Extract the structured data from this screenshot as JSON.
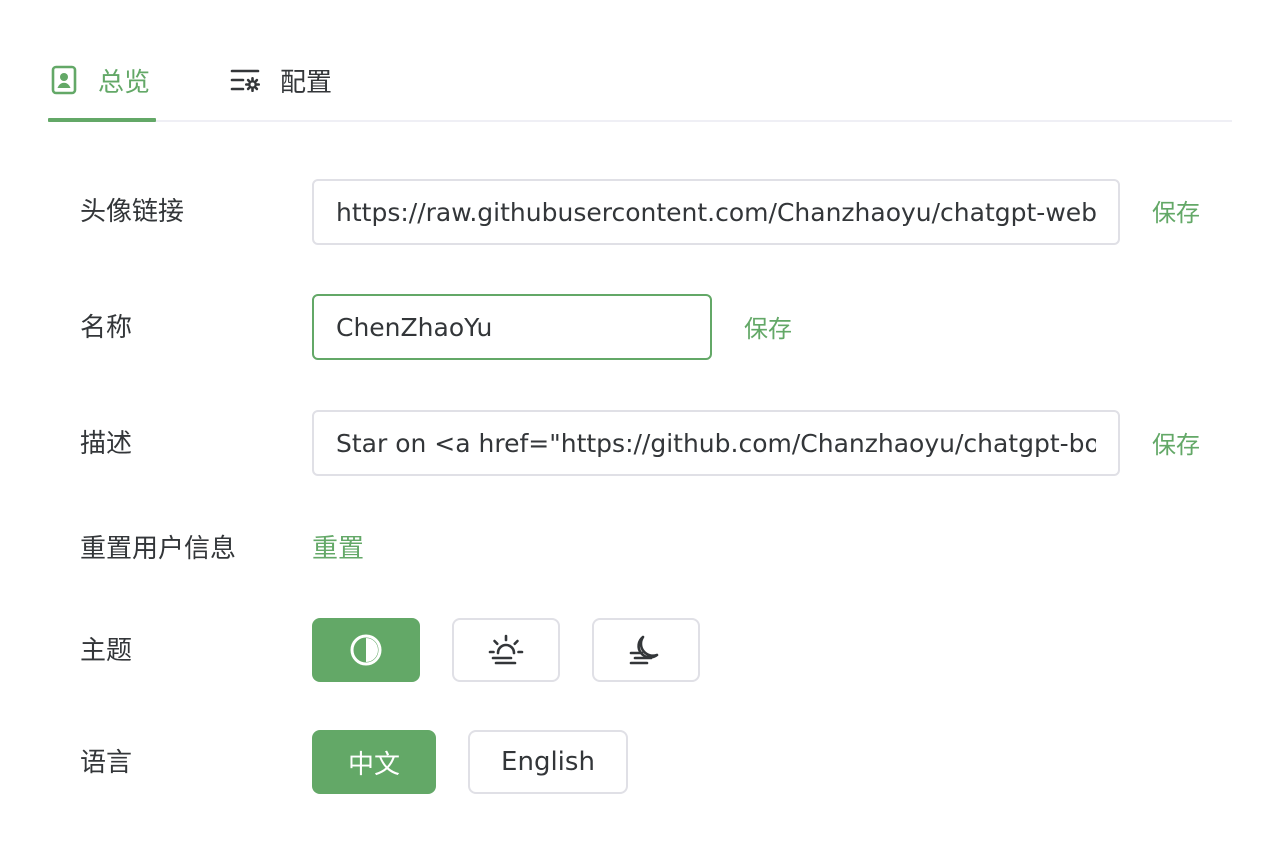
{
  "tabs": [
    {
      "label": "总览",
      "icon": "profile-card-icon",
      "active": true
    },
    {
      "label": "配置",
      "icon": "settings-list-icon",
      "active": false
    }
  ],
  "avatar": {
    "label": "头像链接",
    "value": "https://raw.githubusercontent.com/Chanzhaoyu/chatgpt-web/main/src/assets/avatar.jpg",
    "save_label": "保存"
  },
  "name": {
    "label": "名称",
    "value": "ChenZhaoYu",
    "save_label": "保存"
  },
  "description": {
    "label": "描述",
    "value": "Star on <a href=\"https://github.com/Chanzhaoyu/chatgpt-bot\" class=\"text-blue-500\" target=\"_blank\" >Github</a>",
    "save_label": "保存"
  },
  "reset": {
    "label": "重置用户信息",
    "button_label": "重置"
  },
  "theme": {
    "label": "主题",
    "options": [
      {
        "icon": "contrast-auto-icon",
        "selected": true
      },
      {
        "icon": "sunrise-light-icon",
        "selected": false
      },
      {
        "icon": "moon-dark-icon",
        "selected": false
      }
    ]
  },
  "language": {
    "label": "语言",
    "options": [
      {
        "label": "中文",
        "selected": true
      },
      {
        "label": "English",
        "selected": false
      }
    ]
  },
  "colors": {
    "accent": "#63a867",
    "border": "#e0e0e6",
    "text": "#333639"
  }
}
